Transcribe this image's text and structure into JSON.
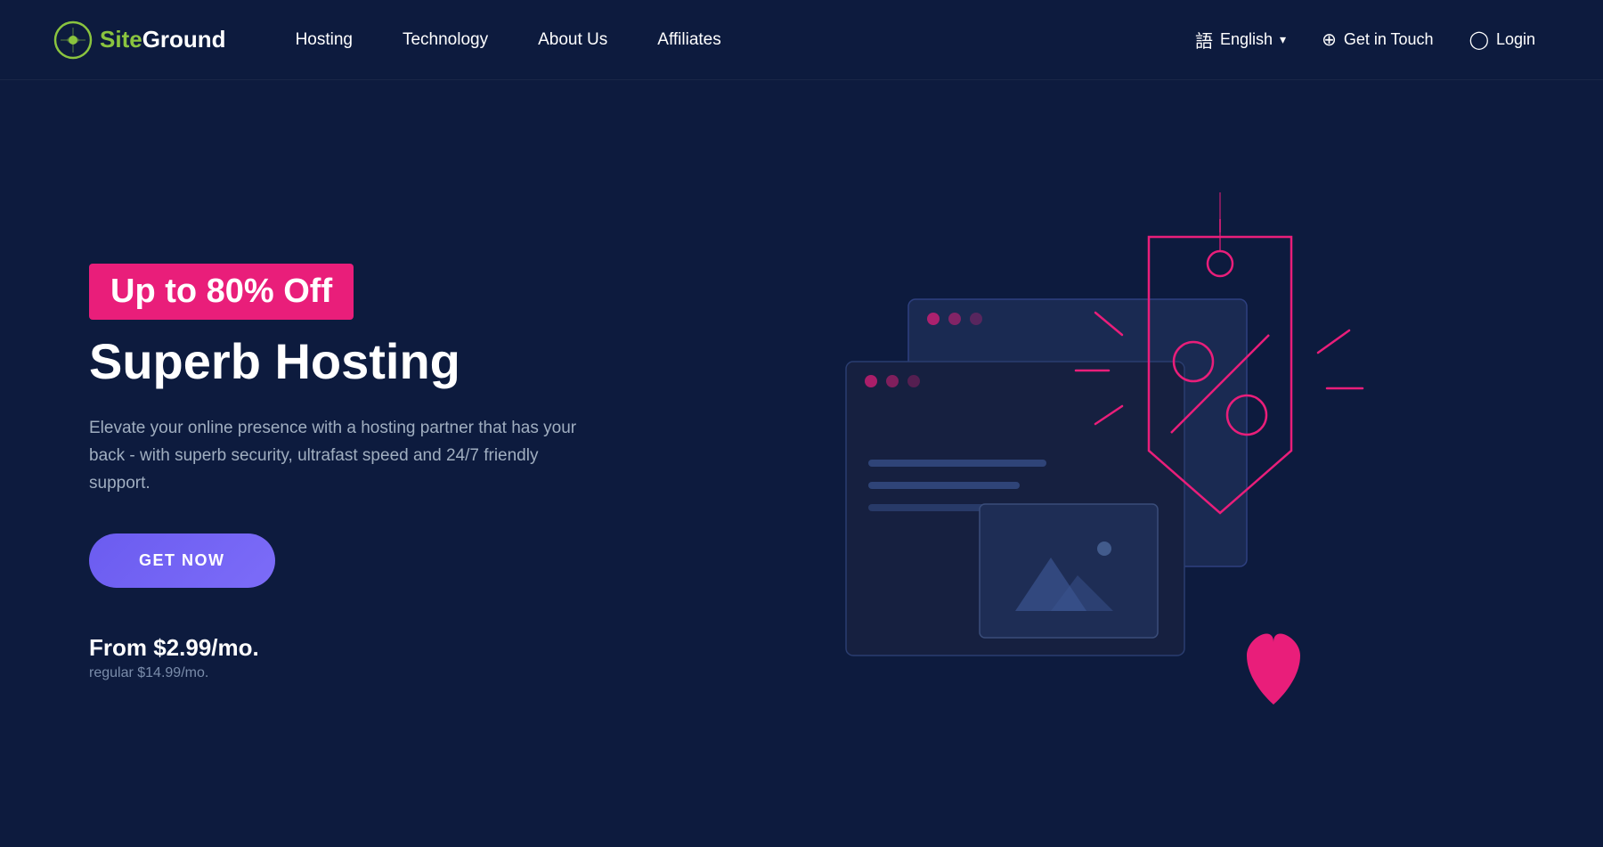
{
  "brand": {
    "logo_text_site": "Site",
    "logo_text_ground": "Ground",
    "logo_alt": "SiteGround"
  },
  "navbar": {
    "links": [
      {
        "label": "Hosting",
        "id": "hosting"
      },
      {
        "label": "Technology",
        "id": "technology"
      },
      {
        "label": "About Us",
        "id": "about-us"
      },
      {
        "label": "Affiliates",
        "id": "affiliates"
      }
    ],
    "right_items": [
      {
        "label": "English",
        "id": "language",
        "icon": "translate",
        "has_chevron": true
      },
      {
        "label": "Get in Touch",
        "id": "contact",
        "icon": "location"
      },
      {
        "label": "Login",
        "id": "login",
        "icon": "user"
      }
    ]
  },
  "hero": {
    "promo_badge": "Up to 80% Off",
    "title": "Superb Hosting",
    "description": "Elevate your online presence with a hosting partner that has your back - with superb security, ultrafast speed and 24/7 friendly support.",
    "cta_label": "GET NOW",
    "price_main": "From $2.99/mo.",
    "price_regular": "regular $14.99/mo.",
    "accent_color": "#e91e7a",
    "cta_color": "#6b5cf0"
  },
  "colors": {
    "bg": "#0d1b3e",
    "card_bg": "#162040",
    "pink": "#e91e7a",
    "purple": "#6b5cf0",
    "blue_line": "#3a4d7a",
    "light_blue": "#4a6fa5"
  }
}
